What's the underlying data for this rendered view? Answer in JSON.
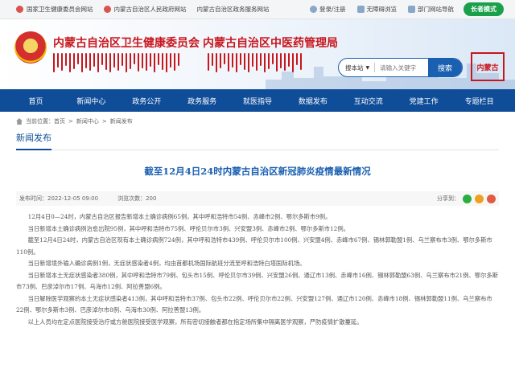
{
  "topbar": {
    "links": [
      "国家卫生健康委员会网站",
      "内蒙古自治区人民政府网站",
      "内蒙古自治区政务服务网站"
    ],
    "login": "登录/注册",
    "accessibility": "无障碍浏览",
    "nav_guide": "部门网站导航",
    "elder_mode": "长者模式"
  },
  "header": {
    "title1": "内蒙古自治区卫生健康委员会",
    "title2": "内蒙古自治区中医药管理局",
    "search_scope": "搜本站",
    "search_placeholder": "请输入关键字",
    "search_button": "搜索",
    "seal_text": "内蒙古"
  },
  "nav": [
    "首页",
    "新闻中心",
    "政务公开",
    "政务服务",
    "就医指导",
    "数据发布",
    "互动交流",
    "党建工作",
    "专题栏目"
  ],
  "breadcrumb": {
    "label": "当前位置：",
    "items": [
      "首页",
      "新闻中心",
      "新闻发布"
    ]
  },
  "section_title": "新闻发布",
  "article": {
    "title": "截至12月4日24时内蒙古自治区新冠肺炎疫情最新情况",
    "publish_label": "发布时间：",
    "publish_time": "2022-12-05 09:00",
    "views_label": "浏览次数：",
    "views": "200",
    "share_label": "分享到：",
    "share_colors": [
      "#2aae3f",
      "#f0a020",
      "#e05b3f"
    ],
    "paragraphs": [
      "12月4日0—24时，内蒙古自治区报告新增本土确诊病例65例，其中呼和浩特市54例、赤峰市2例、鄂尔多斯市9例。",
      "当日新增本土确诊病例治愈出院95例，其中呼和浩特市75例、呼伦贝尔市3例、兴安盟3例、赤峰市2例、鄂尔多斯市12例。",
      "截至12月4日24时，内蒙古自治区现有本土确诊病例724例，其中呼和浩特市439例、呼伦贝尔市100例、兴安盟4例、赤峰市67例、锡林郭勒盟1例、乌兰察布市3例、鄂尔多斯市110例。",
      "当日新增境外输入确诊病例1例，无症状感染者4例，均由首都机场国际航班分流至呼和浩特白塔国际机场。",
      "当日新增本土无症状感染者380例，其中呼和浩特市79例、包头市15例、呼伦贝尔市39例、兴安盟26例、通辽市13例、赤峰市16例、锡林郭勒盟63例、乌兰察布市21例、鄂尔多斯市73例、巴彦淖尔市17例、乌海市12例、阿拉善盟6例。",
      "当日解除医学观察的本土无症状感染者413例，其中呼和浩特市37例、包头市22例、呼伦贝尔市22例、兴安盟127例、通辽市120例、赤峰市18例、锡林郭勒盟11例、乌兰察布市22例、鄂尔多斯市3例、巴彦淖尔市8例、乌海市30例、阿拉善盟13例。",
      "以上人员均在定点医院接受治疗或方舱医院接受医学观察，所有密切接触者都在指定场所集中隔离医学观察，严防疫情扩散蔓延。"
    ]
  }
}
